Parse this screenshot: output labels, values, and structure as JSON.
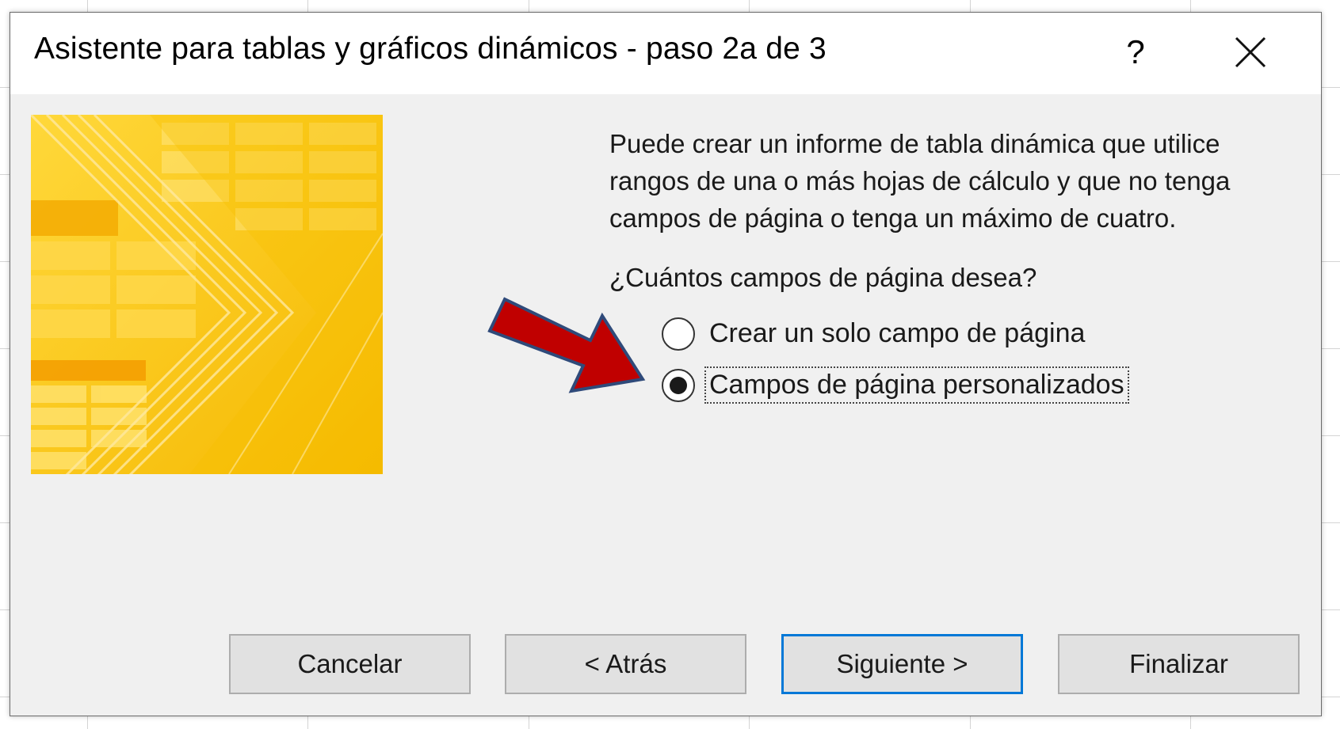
{
  "dialog": {
    "title": "Asistente para tablas y gráficos dinámicos - paso 2a de 3",
    "help_label": "?"
  },
  "content": {
    "description": "Puede crear un informe de tabla dinámica que utilice rangos de una o más hojas de cálculo y que no tenga campos de página o tenga un máximo de cuatro.",
    "question": "¿Cuántos campos de página desea?",
    "options": [
      {
        "label": "Crear un solo campo de página",
        "selected": false
      },
      {
        "label": "Campos de página personalizados",
        "selected": true
      }
    ]
  },
  "buttons": {
    "cancel": "Cancelar",
    "back": "< Atrás",
    "next": "Siguiente >",
    "finish": "Finalizar"
  },
  "colors": {
    "accent": "#0078d7",
    "arrow_fill": "#c00000",
    "arrow_outline": "#2f4a7a",
    "art_yellow": "#f7c600"
  },
  "icons": [
    "help-icon",
    "close-icon",
    "red-arrow-annotation"
  ]
}
